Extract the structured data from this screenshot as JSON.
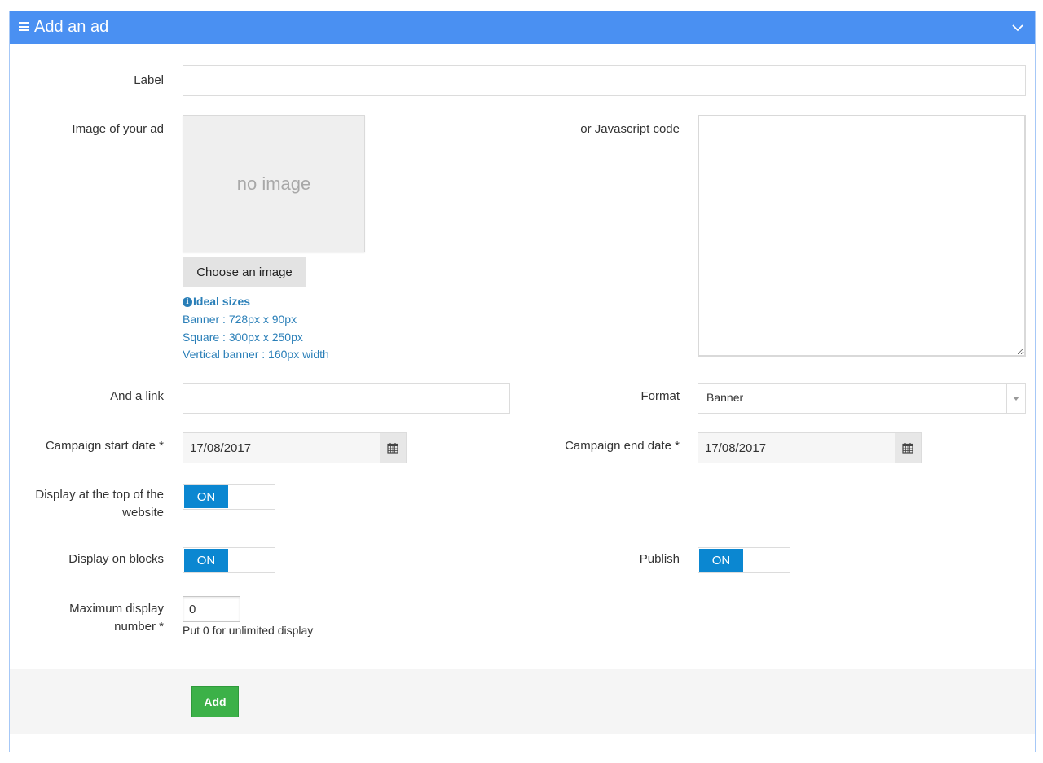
{
  "panel": {
    "title": "Add an ad"
  },
  "form": {
    "label": {
      "label": "Label",
      "value": ""
    },
    "image": {
      "label": "Image of your ad",
      "placeholder_text": "no image",
      "choose_button": "Choose an image",
      "ideal_sizes_title": "Ideal sizes",
      "ideal_sizes": [
        "Banner : 728px x 90px",
        "Square : 300px x 250px",
        "Vertical banner : 160px width"
      ]
    },
    "javascript": {
      "label": "or Javascript code",
      "value": ""
    },
    "link": {
      "label": "And a link",
      "value": ""
    },
    "format": {
      "label": "Format",
      "selected": "Banner"
    },
    "start_date": {
      "label": "Campaign start date *",
      "value": "17/08/2017"
    },
    "end_date": {
      "label": "Campaign end date *",
      "value": "17/08/2017"
    },
    "display_top": {
      "label_line1": "Display at the top of the",
      "label_line2": "website",
      "state": "ON"
    },
    "display_blocks": {
      "label": "Display on blocks",
      "state": "ON"
    },
    "publish": {
      "label": "Publish",
      "state": "ON"
    },
    "max_display": {
      "label_line1": "Maximum display",
      "label_line2": "number *",
      "value": "0",
      "help": "Put 0 for unlimited display"
    }
  },
  "footer": {
    "add_button": "Add"
  },
  "colors": {
    "header": "#4a90f2",
    "toggle_on": "#0b87d1",
    "add_button": "#3cb148",
    "link_text": "#2a7fb8"
  }
}
